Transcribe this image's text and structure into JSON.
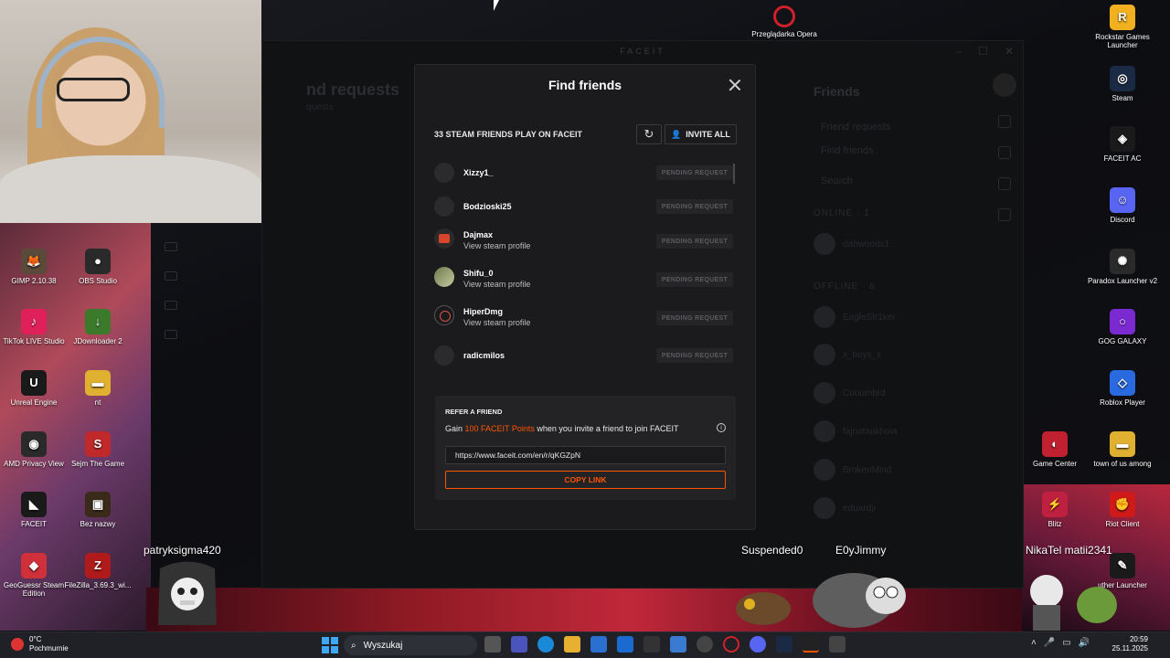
{
  "desktop_left": [
    {
      "label": "GIMP 2.10.38",
      "icon": "gimp-icon",
      "color": "#5b4a3a",
      "glyph": "🦊"
    },
    {
      "label": "OBS Studio",
      "icon": "obs-icon",
      "color": "#2a2a2a",
      "glyph": "●"
    },
    {
      "label": "TikTok LIVE Studio",
      "icon": "tiktok-icon",
      "color": "#e0205a",
      "glyph": "♪"
    },
    {
      "label": "JDownloader 2",
      "icon": "jdownloader-icon",
      "color": "#3a7a2a",
      "glyph": "↓"
    },
    {
      "label": "Unreal Engine",
      "icon": "unreal-icon",
      "color": "#1a1a1a",
      "glyph": "U"
    },
    {
      "label": "nt",
      "icon": "folder-icon",
      "color": "#e0b030",
      "glyph": "▬"
    },
    {
      "label": "AMD Privacy View",
      "icon": "amd-privacy-icon",
      "color": "#2a2a2a",
      "glyph": "◉"
    },
    {
      "label": "Sejm The Game",
      "icon": "sejm-icon",
      "color": "#c0282a",
      "glyph": "S"
    },
    {
      "label": "FACEIT",
      "icon": "faceit-icon",
      "color": "#1a1a1a",
      "glyph": "◣"
    },
    {
      "label": "Bez nazwy",
      "icon": "image-file-icon",
      "color": "#3a2a1a",
      "glyph": "▣"
    },
    {
      "label": "GeoGuessr Steam Edition",
      "icon": "geoguessr-icon",
      "color": "#d0303a",
      "glyph": "◆"
    },
    {
      "label": "FileZilla_3.69.3_wi...",
      "icon": "filezilla-icon",
      "color": "#b01a1a",
      "glyph": "Z"
    }
  ],
  "desktop_right": [
    {
      "label": "Rockstar Games Launcher",
      "icon": "rockstar-icon",
      "color": "#f0b020",
      "glyph": "R"
    },
    {
      "label": "Steam",
      "icon": "steam-icon",
      "color": "#1b2a44",
      "glyph": "◎"
    },
    {
      "label": "FACEIT AC",
      "icon": "faceit-ac-icon",
      "color": "#1a1a1a",
      "glyph": "◈"
    },
    {
      "label": "Discord",
      "icon": "discord-icon",
      "color": "#5865f2",
      "glyph": "☺"
    },
    {
      "label": "Paradox Launcher v2",
      "icon": "paradox-icon",
      "color": "#2a2a2a",
      "glyph": "✺"
    },
    {
      "label": "GOG GALAXY",
      "icon": "gog-icon",
      "color": "#7a2ad0",
      "glyph": "○"
    },
    {
      "label": "Roblox Player",
      "icon": "roblox-icon",
      "color": "#2a6ae0",
      "glyph": "◇"
    },
    {
      "label": "Game Center",
      "icon": "game-center-icon",
      "color": "#c02030",
      "glyph": "◐"
    },
    {
      "label": "town of us among",
      "icon": "folder-icon",
      "color": "#e0b030",
      "glyph": "▬"
    },
    {
      "label": "Blitz",
      "icon": "blitz-icon",
      "color": "#c02040",
      "glyph": "⚡"
    },
    {
      "label": "Riot Client",
      "icon": "riot-icon",
      "color": "#d01a1a",
      "glyph": "✊"
    },
    {
      "label": "uther Launcher",
      "icon": "launcher-icon",
      "color": "#1a1a1a",
      "glyph": "✎"
    }
  ],
  "opera_label": "Przeglądarka Opera",
  "bg_window": {
    "title": "FACEIT",
    "left_title": "nd requests",
    "left_sub": "quests",
    "friends_title": "Friends",
    "items": [
      "Friend requests",
      "Find friends",
      "Search"
    ],
    "online": "ONLINE · 1",
    "offline": "OFFLINE · 6",
    "online_names": [
      "dabwoods1"
    ],
    "offline_names": [
      "EagleStr1ker",
      "x_boys_x",
      "Cuuumbrd",
      "fajnotaakhoia",
      "BrokenMind",
      "eduardjr"
    ]
  },
  "modal": {
    "title": "Find friends",
    "count_label": "33 STEAM FRIENDS PLAY ON FACEIT",
    "invite_all": "INVITE ALL",
    "pending": "PENDING REQUEST",
    "friends": [
      {
        "name": "Xizzy1_",
        "sub": ""
      },
      {
        "name": "Bodzioski25",
        "sub": ""
      },
      {
        "name": "Dajmax",
        "sub": "View steam profile"
      },
      {
        "name": "Shifu_0",
        "sub": "View steam profile"
      },
      {
        "name": "HiperDmg",
        "sub": "View steam profile"
      },
      {
        "name": "radicmilos",
        "sub": ""
      }
    ],
    "refer": {
      "title": "REFER A FRIEND",
      "text_pre": "Gain ",
      "text_hl": "100 FACEIT Points",
      "text_post": " when you invite a friend to join FACEIT",
      "link": "https://www.faceit.com/en/r/qKGZpN",
      "copy": "COPY LINK"
    }
  },
  "stream_names": {
    "left": "patryksigma420",
    "mid1": "Suspended0",
    "mid2": "E0yJimmy",
    "right": "NikaTel matii2341"
  },
  "taskbar": {
    "temp": "0°C",
    "weather": "Pochmurnie",
    "search": "Wyszukaj",
    "time": "20:59",
    "date": "25.11.2025"
  },
  "colors": {
    "accent": "#ff5500",
    "modal_bg": "#1b1b1d"
  }
}
